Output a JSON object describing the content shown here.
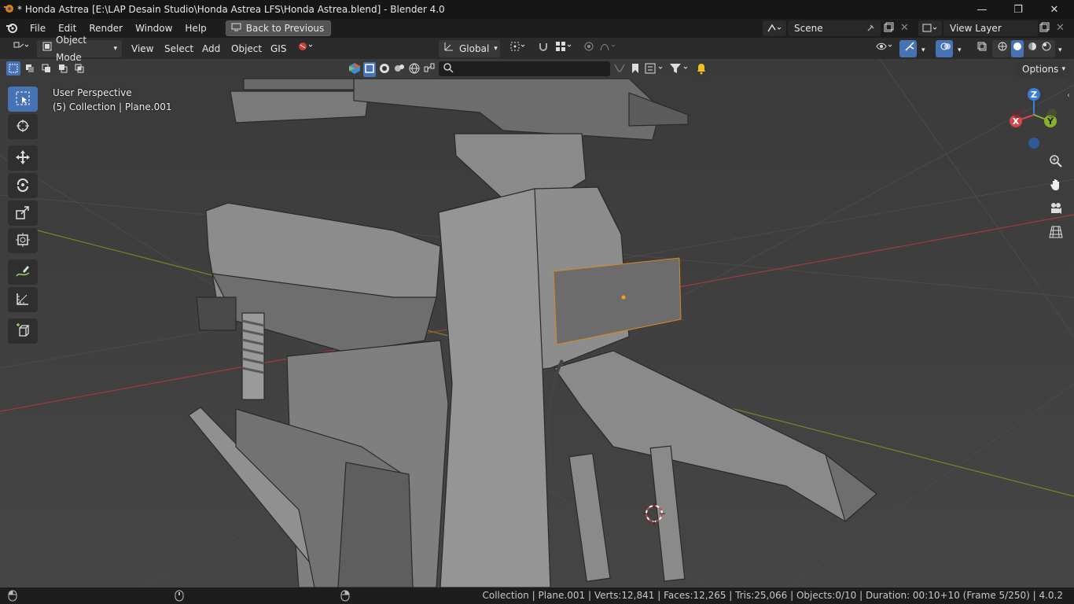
{
  "window": {
    "title": "* Honda Astrea [E:\\LAP Desain Studio\\Honda Astrea LFS\\Honda Astrea.blend] - Blender 4.0",
    "minimize": "—",
    "maximize": "❐",
    "close": "✕"
  },
  "menubar": {
    "items": [
      "File",
      "Edit",
      "Render",
      "Window",
      "Help"
    ],
    "back_button": "Back to Previous",
    "scene_label": "Scene",
    "view_layer_label": "View Layer"
  },
  "header": {
    "mode": "Object Mode",
    "menus": [
      "View",
      "Select",
      "Add",
      "Object",
      "GIS"
    ],
    "transform_orientation": "Global",
    "options": "Options"
  },
  "viewport": {
    "perspective": "User Perspective",
    "collection_info": "(5) Collection | Plane.001",
    "gizmo": {
      "x": "X",
      "y": "Y",
      "z": "Z"
    }
  },
  "statusbar": {
    "text": "Collection | Plane.001 | Verts:12,841 | Faces:12,265 | Tris:25,066 | Objects:0/10 | Duration: 00:10+10 (Frame 5/250) | 4.0.2"
  },
  "colors": {
    "accent": "#4772b3",
    "x_axis": "#d5474d",
    "y_axis": "#8bb12c",
    "z_axis": "#3a7ed6"
  }
}
